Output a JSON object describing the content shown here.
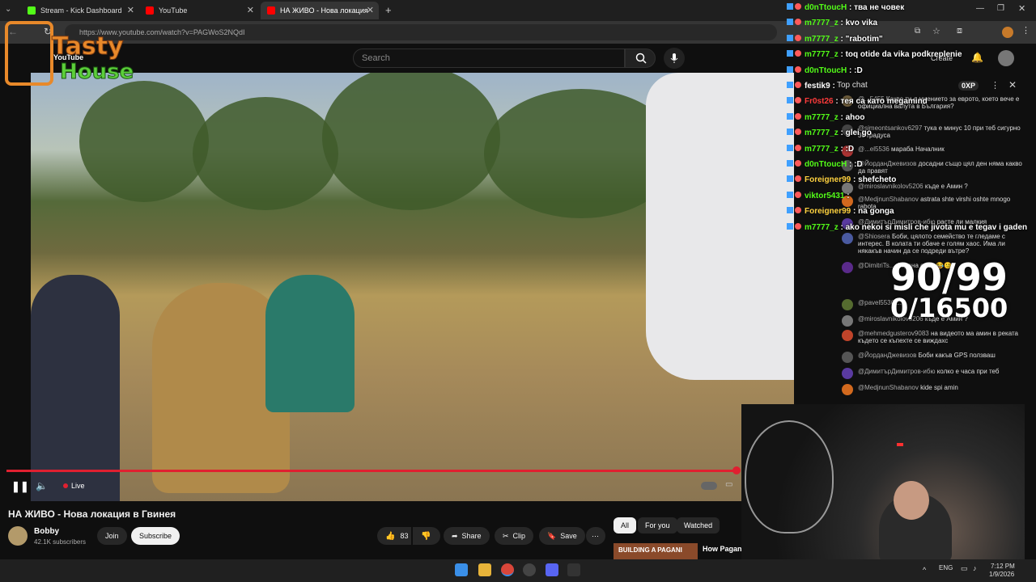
{
  "browser": {
    "tabs": [
      {
        "label": "Stream - Kick Dashboard",
        "color": "#53fc18"
      },
      {
        "label": "YouTube",
        "color": "#ff0000"
      },
      {
        "label": "НА ЖИВО - Нова локация",
        "color": "#ff0000"
      }
    ],
    "url": "https://www.youtube.com/watch?v=PAGWoS2NQdI",
    "new_tab": "+"
  },
  "overlay_logo": {
    "line1": "Tasty",
    "line2": "House",
    "yt_text": "YouTube"
  },
  "youtube": {
    "search_placeholder": "Search",
    "create_label": "Create",
    "player": {
      "live_label": "Live",
      "progress": 0.98
    },
    "video_title": "НА ЖИВО - Нова локация в Гвинея",
    "channel": {
      "name": "Bobby",
      "subscribers": "42.1K subscribers"
    },
    "join_label": "Join",
    "subscribe_label": "Subscribe",
    "likes": "83",
    "share_label": "Share",
    "clip_label": "Clip",
    "save_label": "Save",
    "chips": [
      "All",
      "For you",
      "Watched"
    ],
    "related": {
      "thumb_text": "BUILDING A PAGANI",
      "title": "How Pagani Exclusive ..."
    }
  },
  "yt_chat": {
    "header_label": "Top chat",
    "xp": "0XP",
    "messages": [
      {
        "user": "@...5455",
        "text": "Какво ти е мнението за еврото, което вече е официална валута в България?",
        "color": "#6a5a3a"
      },
      {
        "user": "@simeontsankov6297",
        "text": "тука е минус 10 при теб сигурно 30 градуса",
        "color": "#444"
      },
      {
        "user": "@...el5536",
        "text": "мараба Началник",
        "color": "#a33"
      },
      {
        "user": "@ЙорданДжевизов",
        "text": "досадни също цял ден няма какво да правят",
        "color": "#555"
      },
      {
        "user": "@miroslavnikolov5206",
        "text": "къде е Амин ?",
        "color": "#777"
      },
      {
        "user": "@MedjnunShabanov",
        "text": "astrata shte virshi oshte mnogo rabota",
        "color": "#d2691e"
      },
      {
        "user": "@ДимитърДимитров-ибю",
        "text": "расте ли малкия",
        "color": "#5a3aa0"
      },
      {
        "user": "@Shiosera",
        "text": "Боби, цялото семейство те гледаме с интерес. В колата ти обаче е голям хаос. Има ли някакъв начин да се подреди вътре?",
        "color": "#4a5aa0"
      },
      {
        "user": "@DimitriTs...",
        "text": "Страна от ... 😂🙂",
        "color": "#5a2a8a"
      },
      {
        "user": "@pavel5536",
        "text": "...",
        "color": "#556b2f"
      },
      {
        "user": "@miroslavnikolov5206",
        "text": "къде е Амин ?",
        "color": "#777"
      },
      {
        "user": "@mehmedgusterov9083",
        "text": "на видеото ма амин в реката където се къпехте се виждахс",
        "color": "#c0442a"
      },
      {
        "user": "@ЙорданДжевизов",
        "text": "Боби какъв GPS ползваш",
        "color": "#555"
      },
      {
        "user": "@ДимитърДимитров-ибю",
        "text": "колко е часа при теб",
        "color": "#5a3aa0"
      },
      {
        "user": "@MedjnunShabanov",
        "text": "kide spi amin",
        "color": "#d2691e"
      }
    ]
  },
  "kick_chat": [
    {
      "user": "d0nTtoucH",
      "text": "тва не човек",
      "color": "#53fc18"
    },
    {
      "user": "m7777_z",
      "text": "kvo vika",
      "color": "#53fc18"
    },
    {
      "user": "m7777_z",
      "text": "\"rabotim\"",
      "color": "#53fc18"
    },
    {
      "user": "m7777_z",
      "text": "toq otide da vika podkreplenie",
      "color": "#53fc18"
    },
    {
      "user": "d0nTtoucH",
      "text": ":D",
      "color": "#53fc18"
    },
    {
      "user": "festik9",
      "text": "",
      "color": "#ffffff"
    },
    {
      "user": "Fr0st26",
      "text": "тея са като megamind",
      "color": "#ff3b3b"
    },
    {
      "user": "m7777_z",
      "text": "ahoo",
      "color": "#53fc18"
    },
    {
      "user": "m7777_z",
      "text": "glei go",
      "color": "#53fc18"
    },
    {
      "user": "m7777_z",
      "text": ":D",
      "color": "#53fc18"
    },
    {
      "user": "d0nTtoucH",
      "text": ":D",
      "color": "#53fc18"
    },
    {
      "user": "Foreigner99",
      "text": "shefcheto",
      "color": "#ffd23f"
    },
    {
      "user": "viktor5431",
      "text": "",
      "color": "#53fc18"
    },
    {
      "user": "Foreigner99",
      "text": "na gonga",
      "color": "#ffd23f"
    },
    {
      "user": "m7777_z",
      "text": "ako nekoi si misli che jivota mu e tegav i gaden",
      "color": "#53fc18"
    }
  ],
  "counters": {
    "line1": "90/99",
    "line2": "0/16500"
  },
  "taskbar": {
    "lang": "ENG",
    "time": "7:12 PM",
    "date": "1/9/2026"
  }
}
